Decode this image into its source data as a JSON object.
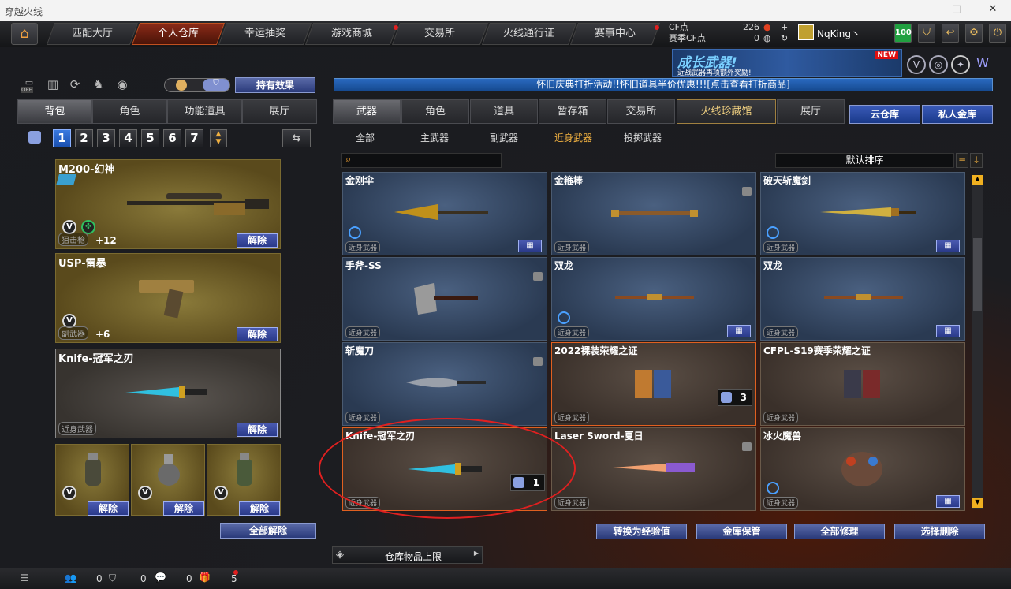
{
  "window": {
    "title": "穿越火线"
  },
  "topnav": {
    "tabs": [
      "匹配大厅",
      "个人仓库",
      "幸运抽奖",
      "游戏商城",
      "交易所",
      "火线通行证",
      "赛事中心"
    ],
    "cf_label": "CF点",
    "cf_value": "226",
    "match_cf_label": "赛季CF点",
    "match_cf_value": "0",
    "username": "NqKing丶",
    "level": "100"
  },
  "banner": {
    "title": "成长武器!",
    "subtitle": "近战武器再项额外奖励!",
    "new_tag": "NEW"
  },
  "marquee": "怀旧庆典打折活动!!怀旧道具半价优惠!!![点击查看打折商品]",
  "left": {
    "toggle_off": "OFF",
    "effects_button": "持有效果",
    "tabs": [
      "背包",
      "角色",
      "功能道具",
      "展厅"
    ],
    "numbers": [
      "1",
      "2",
      "3",
      "4",
      "5",
      "6",
      "7"
    ],
    "items": [
      {
        "name": "M200-幻神",
        "category": "狙击枪",
        "plus": "+12",
        "action": "解除"
      },
      {
        "name": "USP-雷暴",
        "category": "副武器",
        "plus": "+6",
        "action": "解除"
      },
      {
        "name": "Knife-冠军之刃",
        "category": "近身武器",
        "action": "解除"
      }
    ],
    "grenades": [
      {
        "action": "解除"
      },
      {
        "action": "解除"
      },
      {
        "action": "解除"
      }
    ],
    "unequip_all": "全部解除"
  },
  "right": {
    "tabs": [
      "武器",
      "角色",
      "道具",
      "暂存箱",
      "交易所",
      "火线珍藏馆",
      "展厅"
    ],
    "cloud": "云仓库",
    "private": "私人金库",
    "subtabs": [
      "全部",
      "主武器",
      "副武器",
      "近身武器",
      "投掷武器"
    ],
    "sort": "默认排序",
    "cards": [
      {
        "name": "金刚伞",
        "category": "近身武器"
      },
      {
        "name": "金箍棒",
        "category": "近身武器"
      },
      {
        "name": "破天斩魔剑",
        "category": "近身武器"
      },
      {
        "name": "手斧-SS",
        "category": "近身武器"
      },
      {
        "name": "双龙",
        "category": "近身武器"
      },
      {
        "name": "双龙",
        "category": "近身武器"
      },
      {
        "name": "斩魔刀",
        "category": "近身武器"
      },
      {
        "name": "2022裸装荣耀之证",
        "category": "近身武器",
        "qty": "3"
      },
      {
        "name": "CFPL-S19赛季荣耀之证",
        "category": "近身武器"
      },
      {
        "name": "Knife-冠军之刃",
        "category": "近身武器",
        "qty": "1"
      },
      {
        "name": "Laser Sword-夏日",
        "category": "近身武器"
      },
      {
        "name": "冰火魔兽",
        "category": "近身武器"
      }
    ],
    "actions": [
      "转换为经验值",
      "金库保管",
      "全部修理",
      "选择删除"
    ],
    "capacity": "仓库物品上限"
  },
  "bottom": {
    "count1": "0",
    "count2": "0",
    "count3": "0",
    "gift": "5"
  }
}
